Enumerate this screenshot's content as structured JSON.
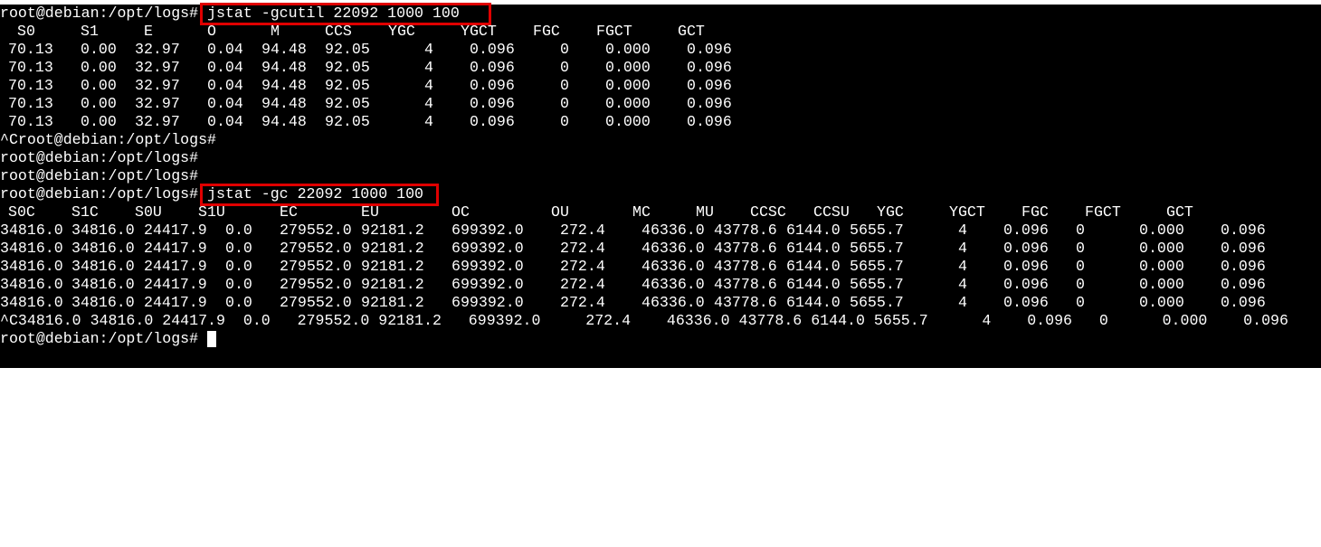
{
  "prompt": "root@debian:/opt/logs#",
  "gcutil": {
    "command": "jstat -gcutil 22092 1000 100",
    "headers": [
      "S0",
      "S1",
      "E",
      "O",
      "M",
      "CCS",
      "YGC",
      "YGCT",
      "FGC",
      "FGCT",
      "GCT"
    ],
    "rows": [
      [
        "70.13",
        "0.00",
        "32.97",
        "0.04",
        "94.48",
        "92.05",
        "4",
        "0.096",
        "0",
        "0.000",
        "0.096"
      ],
      [
        "70.13",
        "0.00",
        "32.97",
        "0.04",
        "94.48",
        "92.05",
        "4",
        "0.096",
        "0",
        "0.000",
        "0.096"
      ],
      [
        "70.13",
        "0.00",
        "32.97",
        "0.04",
        "94.48",
        "92.05",
        "4",
        "0.096",
        "0",
        "0.000",
        "0.096"
      ],
      [
        "70.13",
        "0.00",
        "32.97",
        "0.04",
        "94.48",
        "92.05",
        "4",
        "0.096",
        "0",
        "0.000",
        "0.096"
      ],
      [
        "70.13",
        "0.00",
        "32.97",
        "0.04",
        "94.48",
        "92.05",
        "4",
        "0.096",
        "0",
        "0.000",
        "0.096"
      ]
    ]
  },
  "interrupt_prompt": "^Croot@debian:/opt/logs#",
  "gc": {
    "command": "jstat -gc 22092 1000 100",
    "headers": [
      "S0C",
      "S1C",
      "S0U",
      "S1U",
      "EC",
      "EU",
      "OC",
      "OU",
      "MC",
      "MU",
      "CCSC",
      "CCSU",
      "YGC",
      "YGCT",
      "FGC",
      "FGCT",
      "GCT"
    ],
    "rows": [
      [
        "34816.0",
        "34816.0",
        "24417.9",
        "0.0",
        "279552.0",
        "92181.2",
        "699392.0",
        "272.4",
        "46336.0",
        "43778.6",
        "6144.0",
        "5655.7",
        "4",
        "0.096",
        "0",
        "0.000",
        "0.096"
      ],
      [
        "34816.0",
        "34816.0",
        "24417.9",
        "0.0",
        "279552.0",
        "92181.2",
        "699392.0",
        "272.4",
        "46336.0",
        "43778.6",
        "6144.0",
        "5655.7",
        "4",
        "0.096",
        "0",
        "0.000",
        "0.096"
      ],
      [
        "34816.0",
        "34816.0",
        "24417.9",
        "0.0",
        "279552.0",
        "92181.2",
        "699392.0",
        "272.4",
        "46336.0",
        "43778.6",
        "6144.0",
        "5655.7",
        "4",
        "0.096",
        "0",
        "0.000",
        "0.096"
      ],
      [
        "34816.0",
        "34816.0",
        "24417.9",
        "0.0",
        "279552.0",
        "92181.2",
        "699392.0",
        "272.4",
        "46336.0",
        "43778.6",
        "6144.0",
        "5655.7",
        "4",
        "0.096",
        "0",
        "0.000",
        "0.096"
      ],
      [
        "34816.0",
        "34816.0",
        "24417.9",
        "0.0",
        "279552.0",
        "92181.2",
        "699392.0",
        "272.4",
        "46336.0",
        "43778.6",
        "6144.0",
        "5655.7",
        "4",
        "0.096",
        "0",
        "0.000",
        "0.096"
      ]
    ],
    "interrupted_row": "^C34816.0 34816.0 24417.9  0.0   279552.0 92181.2   699392.0     272.4    46336.0 43778.6 6144.0 5655.7      4    0.096   0      0.000    0.096"
  },
  "colors": {
    "background": "#000000",
    "text": "#ffffff",
    "highlight": "#e00000"
  }
}
